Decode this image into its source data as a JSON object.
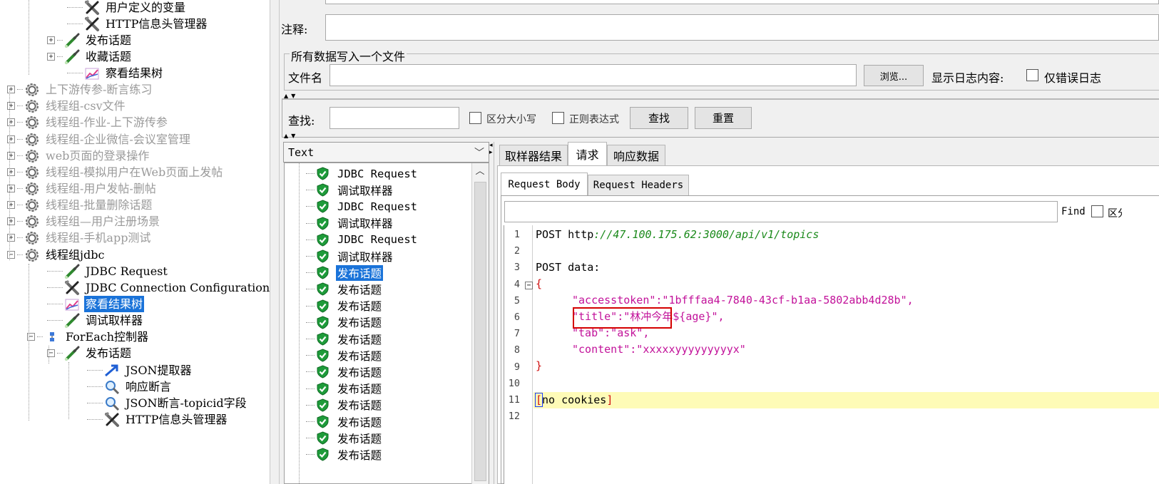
{
  "tree": {
    "items": [
      {
        "label": "用户定义的变量",
        "icon": "wrench-icon",
        "disabled": false,
        "selected": false
      },
      {
        "label": "HTTP信息头管理器",
        "icon": "wrench-icon",
        "disabled": false,
        "selected": false
      },
      {
        "label": "发布话题",
        "icon": "pipette-sampler-icon",
        "disabled": false,
        "selected": false
      },
      {
        "label": "收藏话题",
        "icon": "pipette-sampler-icon",
        "disabled": false,
        "selected": false
      },
      {
        "label": "察看结果树",
        "icon": "graph-listener-icon",
        "disabled": false,
        "selected": false
      },
      {
        "label": "上下游传参-断言练习",
        "icon": "gear-thread-group-icon",
        "disabled": true,
        "selected": false
      },
      {
        "label": "线程组-csv文件",
        "icon": "gear-thread-group-icon",
        "disabled": true,
        "selected": false
      },
      {
        "label": "线程组-作业-上下游传参",
        "icon": "gear-thread-group-icon",
        "disabled": true,
        "selected": false
      },
      {
        "label": "线程组-企业微信-会议室管理",
        "icon": "gear-thread-group-icon",
        "disabled": true,
        "selected": false
      },
      {
        "label": "web页面的登录操作",
        "icon": "gear-thread-group-icon",
        "disabled": true,
        "selected": false
      },
      {
        "label": "线程组-模拟用户在Web页面上发帖",
        "icon": "gear-thread-group-icon",
        "disabled": true,
        "selected": false
      },
      {
        "label": "线程组-用户发帖-删帖",
        "icon": "gear-thread-group-icon",
        "disabled": true,
        "selected": false
      },
      {
        "label": "线程组-批量删除话题",
        "icon": "gear-thread-group-icon",
        "disabled": true,
        "selected": false
      },
      {
        "label": "线程组—用户注册场景",
        "icon": "gear-thread-group-icon",
        "disabled": true,
        "selected": false
      },
      {
        "label": "线程组-手机app测试",
        "icon": "gear-thread-group-icon",
        "disabled": true,
        "selected": false
      },
      {
        "label": "线程组jdbc",
        "icon": "gear-thread-group-icon",
        "disabled": false,
        "selected": false
      },
      {
        "label": "JDBC Request",
        "icon": "pipette-sampler-icon",
        "disabled": false,
        "selected": false
      },
      {
        "label": "JDBC Connection Configuration",
        "icon": "wrench-icon",
        "disabled": false,
        "selected": false
      },
      {
        "label": "察看结果树",
        "icon": "graph-listener-icon",
        "disabled": false,
        "selected": true
      },
      {
        "label": "调试取样器",
        "icon": "pipette-sampler-icon",
        "disabled": false,
        "selected": false
      },
      {
        "label": "ForEach控制器",
        "icon": "controller-icon",
        "disabled": false,
        "selected": false
      },
      {
        "label": "发布话题",
        "icon": "pipette-sampler-icon",
        "disabled": false,
        "selected": false
      },
      {
        "label": "JSON提取器",
        "icon": "arrow-extractor-icon",
        "disabled": false,
        "selected": false
      },
      {
        "label": "响应断言",
        "icon": "magnifier-assertion-icon",
        "disabled": false,
        "selected": false
      },
      {
        "label": "JSON断言-topicid字段",
        "icon": "magnifier-assertion-icon",
        "disabled": false,
        "selected": false
      },
      {
        "label": "HTTP信息头管理器",
        "icon": "wrench-icon",
        "disabled": false,
        "selected": false
      }
    ]
  },
  "form": {
    "comment_label": "注释:",
    "file_group_title": "所有数据写入一个文件",
    "filename_label": "文件名",
    "filename_value": "",
    "browse_label": "浏览...",
    "log_content_label": "显示日志内容:",
    "errors_only_label": "仅错误日志"
  },
  "search": {
    "label": "查找:",
    "value": "",
    "case_label": "区分大小写",
    "regex_label": "正则表达式",
    "find_button": "查找",
    "reset_button": "重置"
  },
  "renderer": {
    "selected": "Text"
  },
  "results": {
    "items": [
      {
        "label": "JDBC Request",
        "selected": false
      },
      {
        "label": "调试取样器",
        "selected": false
      },
      {
        "label": "JDBC Request",
        "selected": false
      },
      {
        "label": "调试取样器",
        "selected": false
      },
      {
        "label": "JDBC Request",
        "selected": false
      },
      {
        "label": "调试取样器",
        "selected": false
      },
      {
        "label": "发布话题",
        "selected": true
      },
      {
        "label": "发布话题",
        "selected": false
      },
      {
        "label": "发布话题",
        "selected": false
      },
      {
        "label": "发布话题",
        "selected": false
      },
      {
        "label": "发布话题",
        "selected": false
      },
      {
        "label": "发布话题",
        "selected": false
      },
      {
        "label": "发布话题",
        "selected": false
      },
      {
        "label": "发布话题",
        "selected": false
      },
      {
        "label": "发布话题",
        "selected": false
      },
      {
        "label": "发布话题",
        "selected": false
      },
      {
        "label": "发布话题",
        "selected": false
      },
      {
        "label": "发布话题",
        "selected": false
      }
    ]
  },
  "tabs": {
    "main": [
      "取样器结果",
      "请求",
      "响应数据"
    ],
    "active_main": 1,
    "sub": [
      "Request Body",
      "Request Headers"
    ],
    "active_sub": 0
  },
  "find_bar": {
    "label": "Find",
    "value": ""
  },
  "code": {
    "line_numbers": [
      "1",
      "2",
      "3",
      "4",
      "5",
      "6",
      "7",
      "8",
      "9",
      "10",
      "11",
      "12"
    ],
    "l1_kw": "POST http",
    "l1_url": "://47.100.175.62:3000/api/v1/topics",
    "l3": "POST data:",
    "l4": "{",
    "l5": "\"accesstoken\":\"1bfffaa4-7840-43cf-b1aa-5802abb4d28b\",",
    "l6": "\"title\":\"林冲今年${age}\",",
    "l7": "\"tab\":\"ask\",",
    "l8": "\"content\":\"xxxxxyyyyyyyyyx\"",
    "l9": "}",
    "l11": "no cookies",
    "highlight_line": 11
  },
  "colors": {
    "selection": "#1a73d9",
    "string": "#c2129a",
    "url": "#1b8a1b",
    "highlight": "#fefbb7",
    "annotation_box": "#d40000"
  }
}
